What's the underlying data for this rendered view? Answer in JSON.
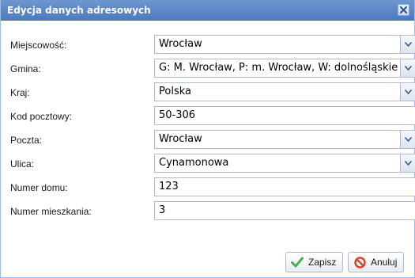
{
  "dialog": {
    "title": "Edycja danych adresowych",
    "close_icon": "close-icon"
  },
  "form": {
    "fields": [
      {
        "label": "Miejscowość:",
        "value": "Wrocław",
        "type": "combo"
      },
      {
        "label": "Gmina:",
        "value": "G: M. Wrocław, P: m. Wrocław, W: dolnośląskie",
        "type": "combo"
      },
      {
        "label": "Kraj:",
        "value": "Polska",
        "type": "combo"
      },
      {
        "label": "Kod pocztowy:",
        "value": "50-306",
        "type": "text"
      },
      {
        "label": "Poczta:",
        "value": "Wrocław",
        "type": "combo"
      },
      {
        "label": "Ulica:",
        "value": "Cynamonowa",
        "type": "combo"
      },
      {
        "label": "Numer domu:",
        "value": "123",
        "type": "text"
      },
      {
        "label": "Numer mieszkania:",
        "value": "3",
        "type": "text"
      }
    ]
  },
  "buttons": {
    "save_label": "Zapisz",
    "save_icon": "checkmark-icon",
    "cancel_label": "Anuluj",
    "cancel_icon": "cancel-icon"
  },
  "colors": {
    "titlebar": "#5683c6",
    "field_border": "#b5b8c8",
    "save_icon": "#4caf50",
    "cancel_icon": "#e0402b"
  }
}
